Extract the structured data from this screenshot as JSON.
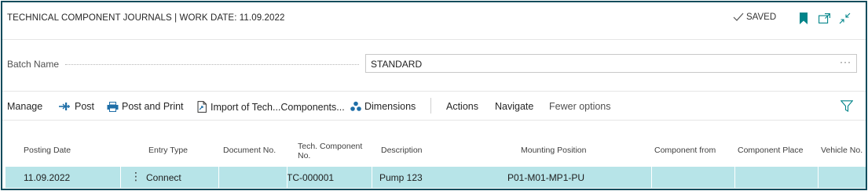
{
  "header": {
    "title": "TECHNICAL COMPONENT JOURNALS | WORK DATE: 11.09.2022",
    "saved_label": "SAVED",
    "icons": [
      "bookmark-icon",
      "open-new-window-icon",
      "collapse-icon"
    ]
  },
  "batch": {
    "label": "Batch Name",
    "value": "STANDARD",
    "more_label": "···"
  },
  "actions": {
    "manage": "Manage",
    "post": "Post",
    "post_and_print": "Post and Print",
    "import": "Import of Tech...Components...",
    "dimensions": "Dimensions",
    "actions": "Actions",
    "navigate": "Navigate",
    "fewer_options": "Fewer options"
  },
  "columns": [
    "Posting Date",
    "Entry Type",
    "Document No.",
    "Tech. Component No.",
    "Description",
    "Mounting Position",
    "Component from",
    "Component Place",
    "Vehicle No."
  ],
  "columns_display": {
    "tech_component_line1": "Tech. Component",
    "tech_component_line2": "No."
  },
  "rows": [
    {
      "posting_date": "11.09.2022",
      "menu": "⋮",
      "entry_type": "Connect",
      "document_no": "",
      "tech_component_no": "TC-000001",
      "description": "Pump 123",
      "mounting_position": "P01-M01-MP1-PU",
      "component_from": "",
      "component_place": "",
      "vehicle_no": ""
    }
  ],
  "colors": {
    "frame_border": "#0f4c5c",
    "accent": "#008489",
    "selected_row": "#b7e4e8"
  }
}
